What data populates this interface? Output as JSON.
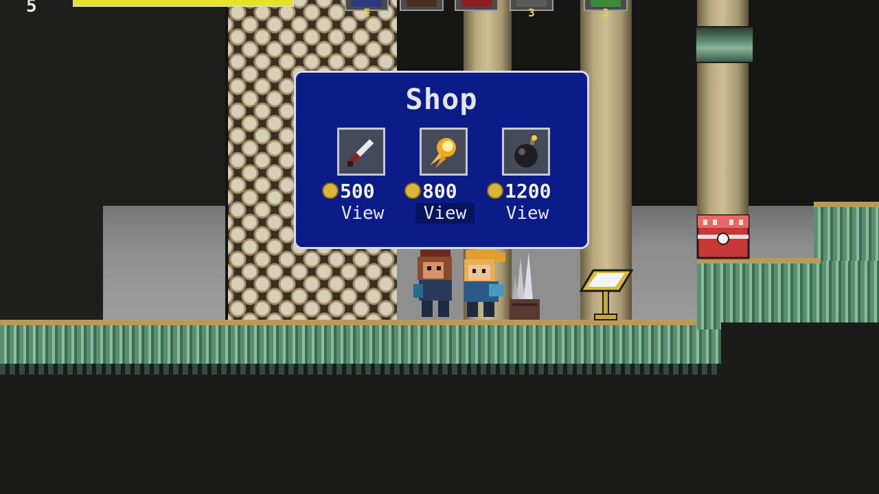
{
  "hud": {
    "level": "5",
    "health_fraction": 1.0,
    "slots": [
      {
        "icon": "item-slot-icon",
        "count": "E"
      },
      {
        "icon": "item-slot-icon",
        "count": ""
      },
      {
        "icon": "item-slot-icon",
        "count": ""
      },
      {
        "icon": "item-slot-icon",
        "count": "3"
      },
      {
        "icon": "item-slot-icon",
        "count": "3"
      }
    ]
  },
  "shop": {
    "title": "Shop",
    "items": [
      {
        "icon": "knife-icon",
        "price": "500",
        "view_label": "View"
      },
      {
        "icon": "fireball-icon",
        "price": "800",
        "view_label": "View"
      },
      {
        "icon": "bomb-icon",
        "price": "1200",
        "view_label": "View"
      }
    ],
    "selected_index": 1
  },
  "colors": {
    "dialog_bg": "#0b1b88",
    "dialog_border": "#d8dde8",
    "health": "#e6e22a",
    "coin": "#d8b638"
  }
}
